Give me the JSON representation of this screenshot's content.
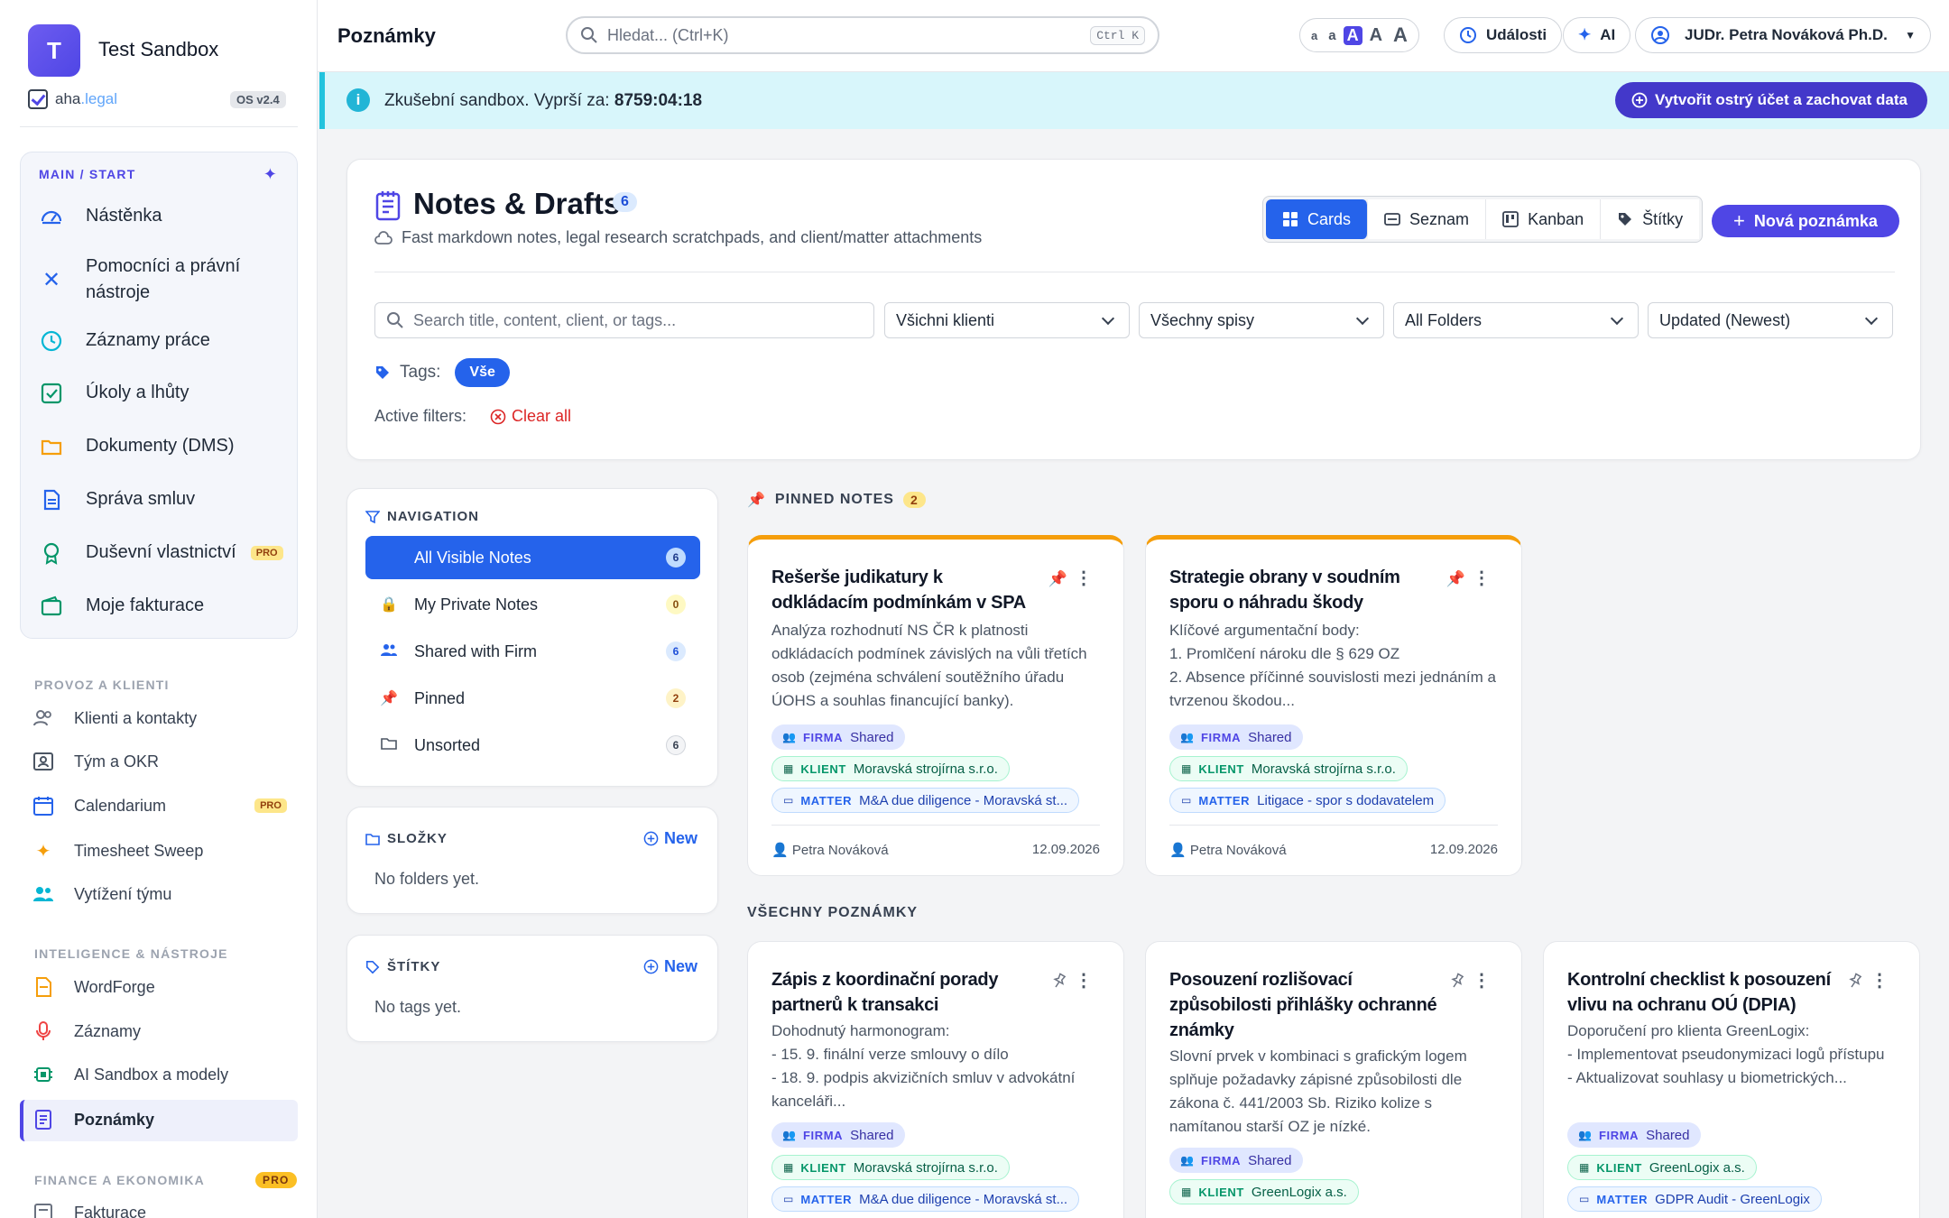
{
  "sidebar": {
    "org_initial": "T",
    "org_name": "Test Sandbox",
    "brand_prefix": "aha",
    "brand_suffix": ".legal",
    "version": "OS v2.4",
    "main_group_title": "MAIN / START",
    "main_items": [
      {
        "label": "Nástěnka",
        "icon": "gauge-icon"
      },
      {
        "label": "Pomocníci a právní nástroje",
        "icon": "tools-icon"
      },
      {
        "label": "Záznamy práce",
        "icon": "clock-icon"
      },
      {
        "label": "Úkoly a lhůty",
        "icon": "checkbox-icon"
      },
      {
        "label": "Dokumenty (DMS)",
        "icon": "folder-icon"
      },
      {
        "label": "Správa smluv",
        "icon": "document-icon"
      },
      {
        "label": "Duševní vlastnictví",
        "icon": "award-icon",
        "badge": "PRO"
      },
      {
        "label": "Moje fakturace",
        "icon": "wallet-icon"
      }
    ],
    "group2_title": "PROVOZ A KLIENTI",
    "group2_items": [
      {
        "label": "Klienti a kontakty",
        "icon": "users-icon"
      },
      {
        "label": "Tým a OKR",
        "icon": "id-card-icon"
      },
      {
        "label": "Calendarium",
        "icon": "calendar-icon",
        "badge": "PRO"
      },
      {
        "label": "Timesheet Sweep",
        "icon": "sparkle-icon"
      },
      {
        "label": "Vytížení týmu",
        "icon": "team-icon"
      }
    ],
    "group3_title": "INTELIGENCE & NÁSTROJE",
    "group3_items": [
      {
        "label": "WordForge",
        "icon": "file-icon"
      },
      {
        "label": "Záznamy",
        "icon": "microphone-icon"
      },
      {
        "label": "AI Sandbox a modely",
        "icon": "chip-icon"
      },
      {
        "label": "Poznámky",
        "icon": "notes-icon",
        "active": true
      }
    ],
    "group4_title": "FINANCE A EKONOMIKA",
    "group4_badge": "PRO",
    "group4_items": [
      {
        "label": "Fakturace",
        "icon": "invoice-icon"
      }
    ]
  },
  "topbar": {
    "page_name": "Poznámky",
    "search_placeholder": "Hledat... (Ctrl+K)",
    "search_kbd": "Ctrl K",
    "font_sizes": [
      "a",
      "a",
      "A",
      "A",
      "A"
    ],
    "events_label": "Události",
    "ai_label": "AI",
    "user_label": "JUDr. Petra Nováková Ph.D."
  },
  "banner": {
    "text": "Zkušební sandbox. Vyprší za:",
    "countdown": "8759:04:18",
    "cta": "Vytvořit ostrý účet a zachovat data"
  },
  "header": {
    "title": "Notes & Drafts",
    "count": "6",
    "subtitle": "Fast markdown notes, legal research scratchpads, and client/matter attachments",
    "views": [
      "Cards",
      "Seznam",
      "Kanban",
      "Štítky"
    ],
    "active_view": "Cards",
    "new_note": "Nová poznámka",
    "search_placeholder": "Search title, content, client, or tags...",
    "filters": [
      "Všichni klienti",
      "Všechny spisy",
      "All Folders",
      "Updated (Newest)"
    ],
    "tags_label": "Tags:",
    "tag_all": "Vše",
    "active_filters_label": "Active filters:",
    "clear_all": "Clear all"
  },
  "navigation": {
    "title": "NAVIGATION",
    "items": [
      {
        "label": "All Visible Notes",
        "count": "6",
        "icon": "",
        "active": true
      },
      {
        "label": "My Private Notes",
        "count": "0",
        "icon": "lock-icon"
      },
      {
        "label": "Shared with Firm",
        "count": "6",
        "icon": "users-icon"
      },
      {
        "label": "Pinned",
        "count": "2",
        "icon": "pin-icon"
      },
      {
        "label": "Unsorted",
        "count": "6",
        "icon": "folder-icon"
      }
    ]
  },
  "folders": {
    "title": "SLOŽKY",
    "new": "New",
    "empty": "No folders yet."
  },
  "tags": {
    "title": "ŠTÍTKY",
    "new": "New",
    "empty": "No tags yet."
  },
  "pinned_section": {
    "title": "PINNED NOTES",
    "count": "2"
  },
  "all_section": {
    "title": "VŠECHNY POZNÁMKY"
  },
  "notes": [
    {
      "title": "Rešerše judikatury k odkládacím podmínkám v SPA",
      "body": "Analýza rozhodnutí NS ČR k platnosti odkládacích podmínek závislých na vůli třetích osob (zejména schválení soutěžního úřadu ÚOHS a souhlas financující banky).",
      "firma": "Shared",
      "klient": "Moravská strojírna s.r.o.",
      "matter": "M&A due diligence - Moravská st...",
      "author": "Petra Nováková",
      "date": "12.09.2026",
      "pinned": true
    },
    {
      "title": "Strategie obrany v soudním sporu o náhradu škody",
      "body": "Klíčové argumentační body:\n1. Promlčení nároku dle § 629 OZ\n2. Absence příčinné souvislosti mezi jednáním a tvrzenou škodou...",
      "firma": "Shared",
      "klient": "Moravská strojírna s.r.o.",
      "matter": "Litigace - spor s dodavatelem",
      "author": "Petra Nováková",
      "date": "12.09.2026",
      "pinned": true
    },
    {
      "title": "Zápis z koordinační porady partnerů k transakci",
      "body": "Dohodnutý harmonogram:\n- 15. 9. finální verze smlouvy o dílo\n- 18. 9. podpis akvizičních smluv v advokátní kanceláři...",
      "firma": "Shared",
      "klient": "Moravská strojírna s.r.o.",
      "matter": "M&A due diligence - Moravská st..."
    },
    {
      "title": "Posouzení rozlišovací způsobilosti přihlášky ochranné známky",
      "body": "Slovní prvek v kombinaci s grafickým logem splňuje požadavky zápisné způsobilosti dle zákona č. 441/2003 Sb. Riziko kolize s namítanou starší OZ je nízké.",
      "firma": "Shared",
      "klient": "GreenLogix a.s."
    },
    {
      "title": "Kontrolní checklist k posouzení vlivu na ochranu OÚ (DPIA)",
      "body": "Doporučení pro klienta GreenLogix:\n- Implementovat pseudonymizaci logů přístupu\n- Aktualizovat souhlasy u biometrických...",
      "firma": "Shared",
      "klient": "GreenLogix a.s.",
      "matter": "GDPR Audit - GreenLogix"
    }
  ],
  "labels": {
    "firma": "FIRMA",
    "klient": "KLIENT",
    "matter": "MATTER"
  },
  "colors": {
    "accent": "#4f46e5",
    "primary": "#2563eb",
    "pinned": "#f59e0b",
    "banner": "#d8f6fb"
  }
}
